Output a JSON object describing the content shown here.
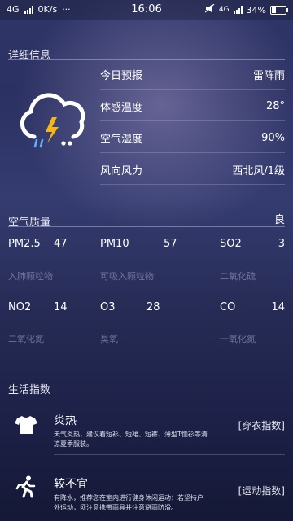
{
  "status": {
    "network": "4G",
    "speed": "0K/s",
    "time": "16:06",
    "network2": "4G",
    "battery": "34%",
    "battery_level": 0.34
  },
  "details": {
    "title": "详细信息",
    "icon": "thunderstorm-icon",
    "rows": [
      {
        "label": "今日预报",
        "value": "雷阵雨"
      },
      {
        "label": "体感温度",
        "value": "28°"
      },
      {
        "label": "空气湿度",
        "value": "90%"
      },
      {
        "label": "风向风力",
        "value": "西北风/1级"
      }
    ]
  },
  "air": {
    "title": "空气质量",
    "level": "良",
    "items": [
      {
        "name": "PM2.5",
        "value": "47",
        "desc": "入肺颗粒物"
      },
      {
        "name": "PM10",
        "value": "57",
        "desc": "可吸入颗粒物"
      },
      {
        "name": "SO2",
        "value": "3",
        "desc": "二氧化硫"
      },
      {
        "name": "NO2",
        "value": "14",
        "desc": "二氧化氮"
      },
      {
        "name": "O3",
        "value": "28",
        "desc": "臭氧"
      },
      {
        "name": "CO",
        "value": "14",
        "desc": "一氧化氮"
      }
    ]
  },
  "life": {
    "title": "生活指数",
    "items": [
      {
        "icon": "tshirt-icon",
        "title": "炎热",
        "desc": "天气炎热，建议着短衫、短裙、短裤、薄型T恤衫等清凉夏季服装。",
        "tag": "[穿衣指数]"
      },
      {
        "icon": "running-icon",
        "title": "较不宜",
        "desc": "有降水，推荐您在室内进行健身休闲运动；若坚持户外运动，须注意携带雨具并注意避雨防滑。",
        "tag": "[运动指数]"
      }
    ]
  }
}
